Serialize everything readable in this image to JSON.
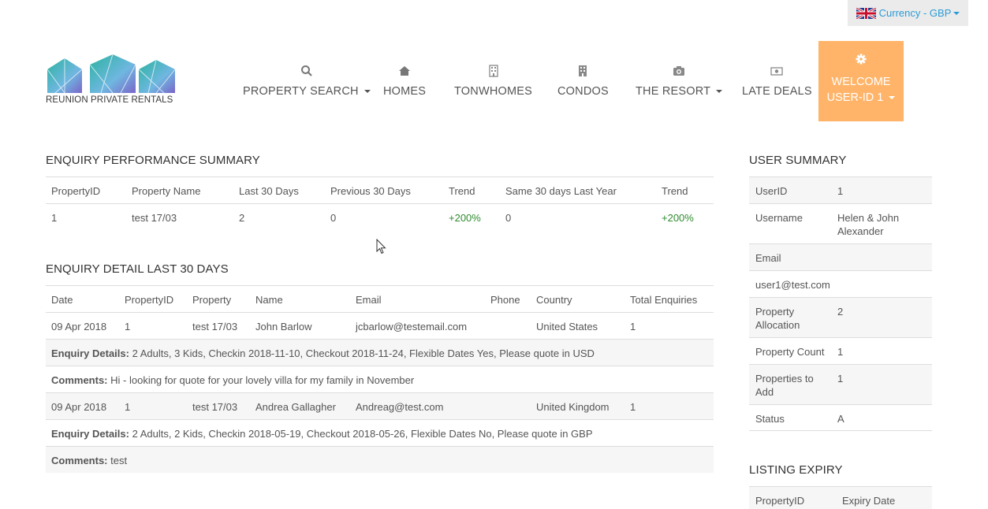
{
  "currency": {
    "label": "Currency - GBP"
  },
  "logo": {
    "text": "REUNION PRIVATE RENTALS"
  },
  "nav": {
    "items": [
      {
        "label": "PROPERTY SEARCH",
        "icon": "search-icon"
      },
      {
        "label": "HOMES",
        "icon": "home-icon"
      },
      {
        "label": "TONWHOMES",
        "icon": "building-icon"
      },
      {
        "label": "CONDOS",
        "icon": "building-icon"
      },
      {
        "label": "THE RESORT",
        "icon": "camera-icon"
      },
      {
        "label": "LATE DEALS",
        "icon": "money-icon"
      }
    ],
    "welcome": {
      "line1": "WELCOME",
      "line2": "USER-ID 1"
    }
  },
  "colors": {
    "accent": "#ffb469",
    "link": "#2a9bd6",
    "trend": "#2e8b2e"
  },
  "performance": {
    "title": "ENQUIRY PERFORMANCE SUMMARY",
    "headers": [
      "PropertyID",
      "Property Name",
      "Last 30 Days",
      "Previous 30 Days",
      "Trend",
      "Same 30 days Last Year",
      "Trend"
    ],
    "rows": [
      [
        "1",
        "test 17/03",
        "2",
        "0",
        "+200%",
        "0",
        "+200%"
      ]
    ]
  },
  "detail": {
    "title": "ENQUIRY DETAIL LAST 30 DAYS",
    "headers": [
      "Date",
      "PropertyID",
      "Property",
      "Name",
      "Email",
      "Phone",
      "Country",
      "Total Enquiries"
    ],
    "details_label": "Enquiry Details:",
    "comments_label": "Comments:",
    "rows": [
      {
        "cells": [
          "09 Apr 2018",
          "1",
          "test 17/03",
          "John Barlow",
          "jcbarlow@testemail.com",
          "",
          "United States",
          "1"
        ],
        "details": "2 Adults, 3 Kids, Checkin 2018-11-10, Checkout 2018-11-24, Flexible Dates Yes, Please quote in USD",
        "comments": "Hi - looking for quote for your lovely villa for my family in November"
      },
      {
        "cells": [
          "09 Apr 2018",
          "1",
          "test 17/03",
          "Andrea Gallagher",
          "Andreag@test.com",
          "",
          "United Kingdom",
          "1"
        ],
        "details": "2 Adults, 2 Kids, Checkin 2018-05-19, Checkout 2018-05-26, Flexible Dates No, Please quote in GBP",
        "comments": "test"
      }
    ]
  },
  "user_summary": {
    "title": "USER SUMMARY",
    "userid_label": "UserID",
    "userid": "1",
    "username_label": "Username",
    "username_line1": "Helen & John",
    "username_line2": "Alexander",
    "email_label": "Email",
    "email": "user1@test.com",
    "alloc_label1": "Property",
    "alloc_label2": "Allocation",
    "alloc": "2",
    "count_label": "Property Count",
    "count": "1",
    "add_label1": "Properties to",
    "add_label2": "Add",
    "add": "1",
    "status_label": "Status",
    "status": "A"
  },
  "listing_expiry": {
    "title": "LISTING EXPIRY",
    "headers": [
      "PropertyID",
      "Expiry Date"
    ]
  }
}
